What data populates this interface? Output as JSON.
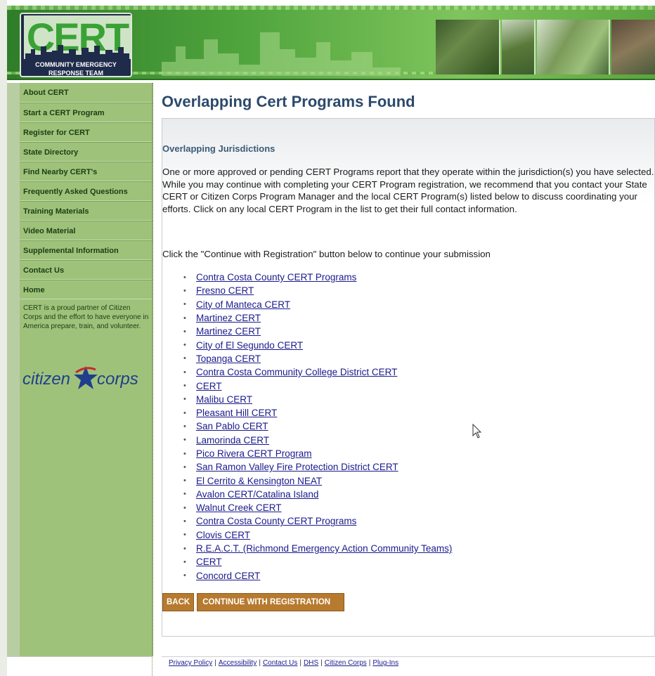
{
  "header": {
    "logo": {
      "title": "CERT",
      "subtitle_line1": "COMMUNITY EMERGENCY",
      "subtitle_line2": "RESPONSE TEAM"
    }
  },
  "sidebar": {
    "items": [
      {
        "label": "About CERT"
      },
      {
        "label": "Start a CERT Program"
      },
      {
        "label": "Register for CERT"
      },
      {
        "label": "State Directory"
      },
      {
        "label": "Find Nearby CERT's"
      },
      {
        "label": "Frequently Asked Questions"
      },
      {
        "label": "Training Materials"
      },
      {
        "label": "Video Material"
      },
      {
        "label": "Supplemental Information"
      },
      {
        "label": "Contact Us"
      },
      {
        "label": "Home"
      }
    ],
    "partner_text": "CERT is a proud partner of Citizen Corps and the effort to have everyone in America prepare, train, and volunteer.",
    "partner_logo": {
      "left": "citizen",
      "right": "corps",
      "icon": "star-icon"
    }
  },
  "main": {
    "title": "Overlapping Cert Programs Found",
    "section_title": "Overlapping Jurisdictions",
    "paragraph": "One or more approved or pending CERT Programs report that they operate within the jurisdiction(s) you have selected. While you may continue with completing your CERT Program registration, we recommend that you contact your State CERT or Citizen Corps Program Manager and the local CERT Program(s) listed below to discuss coordinating your efforts. Click on any local CERT Program in the list to get their full contact information.",
    "instruction": "Click the \"Continue with Registration\" button below to continue your submission",
    "programs": [
      "Contra Costa County CERT Programs",
      "Fresno CERT",
      "City of Manteca CERT",
      "Martinez CERT",
      "Martinez CERT",
      "City of El Segundo CERT",
      "Topanga CERT",
      "Contra Costa Community College District CERT",
      "CERT",
      "Malibu CERT",
      "Pleasant Hill CERT",
      "San Pablo CERT",
      "Lamorinda CERT",
      "Pico Rivera CERT Program",
      "San Ramon Valley Fire Protection District CERT",
      "El Cerrito & Kensington NEAT",
      "Avalon CERT/Catalina Island",
      "Walnut Creek CERT",
      "Contra Costa County CERT Programs",
      "Clovis CERT",
      "R.E.A.C.T. (Richmond Emergency Action Community Teams)",
      "CERT",
      "Concord CERT"
    ],
    "back_label": "BACK",
    "continue_label": "CONTINUE WITH REGISTRATION"
  },
  "footer": {
    "links": [
      "Privacy Policy",
      "Accessibility",
      "Contact Us",
      "DHS",
      "Citizen Corps",
      "Plug-Ins"
    ],
    "separator": "|"
  },
  "colors": {
    "header_green": "#4ea33c",
    "sidebar_green": "#9fc27b",
    "title_blue": "#2c4a6b",
    "button_brown": "#b77a2e",
    "link_blue": "#1a1a8c"
  }
}
